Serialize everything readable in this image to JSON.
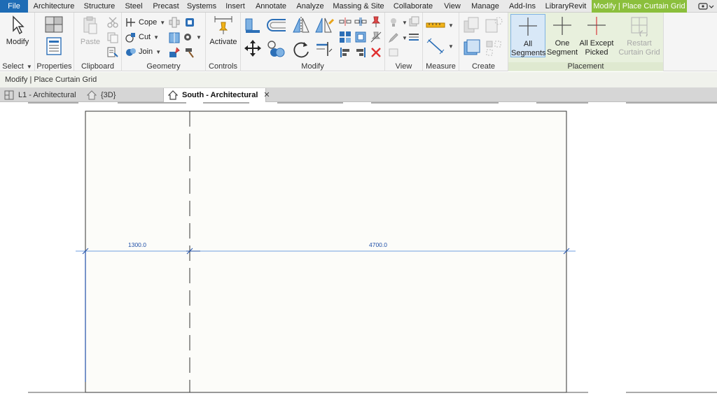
{
  "menu": {
    "tabs": [
      "File",
      "Architecture",
      "Structure",
      "Steel",
      "Precast",
      "Systems",
      "Insert",
      "Annotate",
      "Analyze",
      "Massing & Site",
      "Collaborate",
      "View",
      "Manage",
      "Add-Ins",
      "LibraryRevit",
      "Modify | Place Curtain Grid"
    ]
  },
  "ribbon": {
    "select": {
      "modify_label": "Modify",
      "panel_label": "Select"
    },
    "properties": {
      "panel_label": "Properties"
    },
    "clipboard": {
      "paste_label": "Paste",
      "panel_label": "Clipboard"
    },
    "geometry": {
      "cope_label": "Cope",
      "cut_label": "Cut",
      "join_label": "Join",
      "panel_label": "Geometry"
    },
    "controls": {
      "activate_label": "Activate",
      "panel_label": "Controls"
    },
    "modify": {
      "panel_label": "Modify"
    },
    "view": {
      "panel_label": "View"
    },
    "measure": {
      "panel_label": "Measure"
    },
    "create": {
      "panel_label": "Create"
    },
    "placement": {
      "panel_label": "Placement",
      "all_segments_label": "All\nSegments",
      "one_segment_label": "One\nSegment",
      "all_except_label": "All Except\nPicked",
      "restart_label": "Restart\nCurtain Grid"
    }
  },
  "options_bar": {
    "text": "Modify | Place Curtain Grid"
  },
  "view_tabs": [
    {
      "label": "L1 - Architectural",
      "active": false
    },
    {
      "label": "{3D}",
      "active": false
    },
    {
      "label": "South - Architectural",
      "active": true
    }
  ],
  "drawing": {
    "dim_left": "1300.0",
    "dim_right": "4700.0"
  },
  "colors": {
    "file_tab": "#1e6cb5",
    "context_tab": "#8bbf3c",
    "dimension": "#1f4fa8",
    "selection": "#7fb2e3"
  }
}
